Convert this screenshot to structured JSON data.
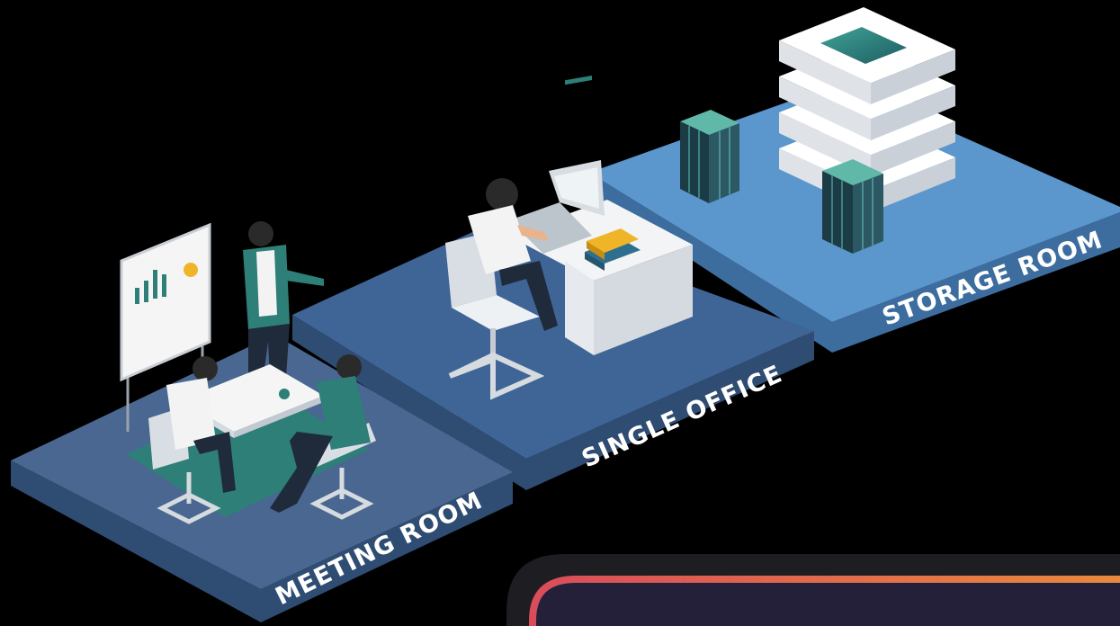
{
  "platforms": [
    {
      "id": "meeting-room",
      "label": "MEETING ROOM"
    },
    {
      "id": "single-office",
      "label": "SINGLE OFFICE"
    },
    {
      "id": "storage-room",
      "label": "STORAGE ROOM"
    }
  ],
  "colors": {
    "background": "#000000",
    "platform_top_meeting": "#4a6791",
    "platform_top_office": "#3f6496",
    "platform_top_storage": "#5b96cc",
    "platform_side_dark": "#2f4c72",
    "accent_teal": "#2e7f78",
    "label_text": "#ffffff",
    "gradient_start": "#d94d5a",
    "gradient_end": "#e8893d"
  }
}
